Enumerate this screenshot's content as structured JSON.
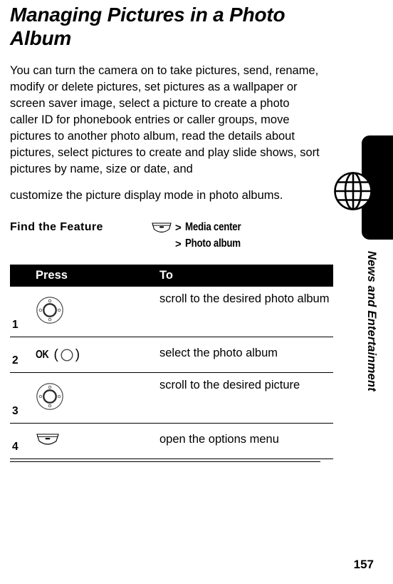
{
  "page": {
    "number": "157",
    "section_label": "News and Entertainment",
    "section_icon": "globe-icon"
  },
  "article": {
    "title": "Managing Pictures in a Photo Album",
    "intro_paragraph": "You can turn the camera on to take pictures, send, rename, modify or delete pictures, set pictures as a wallpaper or screen saver image, select a picture to create a photo caller ID for phonebook entries or caller groups, move pictures to another photo album, read the details about pictures, select pictures to create and play slide shows, sort pictures by name, size or date, and",
    "intro_paragraph_continued": "customize the picture display mode in photo albums."
  },
  "find_the_feature": {
    "label": "Find the Feature",
    "key_icon": "menu-soft-key-icon",
    "separator": ">",
    "path": [
      "Media center",
      "Photo album"
    ]
  },
  "steps_table": {
    "headers": {
      "number": "",
      "press": "Press",
      "to": "To"
    },
    "rows": [
      {
        "number": "1",
        "press_icon": "navigation-key-icon",
        "press_label": "",
        "to": "scroll to the desired photo album"
      },
      {
        "number": "2",
        "press_icon": "ok-key-icon",
        "press_label": "OK",
        "paren_open": "(",
        "paren_close": ")",
        "to": "select the photo album"
      },
      {
        "number": "3",
        "press_icon": "navigation-key-icon",
        "press_label": "",
        "to": "scroll to the desired picture"
      },
      {
        "number": "4",
        "press_icon": "menu-soft-key-icon",
        "press_label": "",
        "to": "open the options menu"
      }
    ]
  },
  "colors": {
    "ink": "#000000",
    "paper": "#ffffff",
    "header_band": "#000000"
  }
}
